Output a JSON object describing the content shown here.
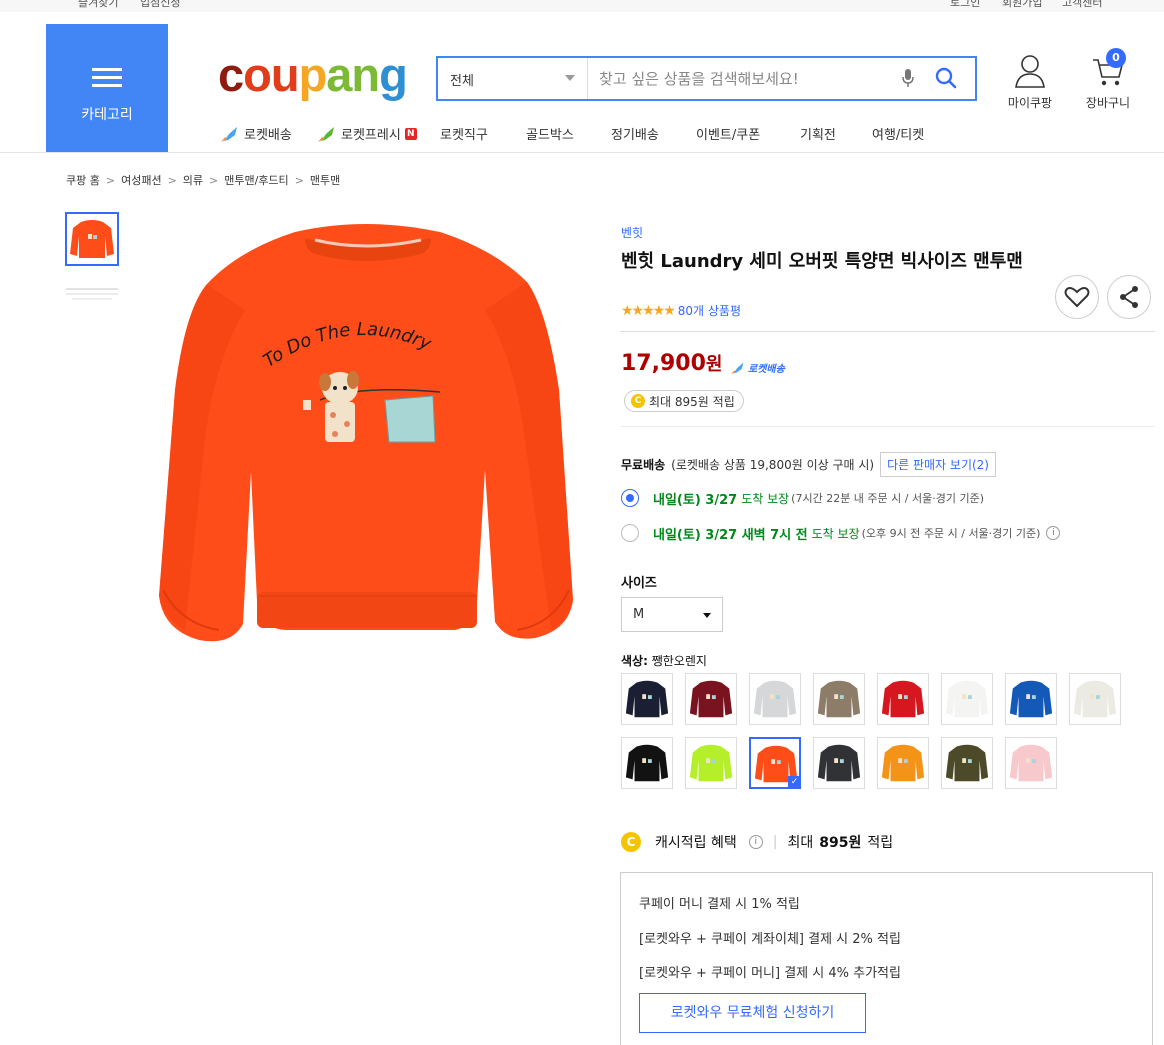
{
  "topbar": {
    "left_a": "즐겨찾기",
    "left_b": "입점신청",
    "right_a": "로그인",
    "right_b": "회원가입",
    "right_c": "고객센터"
  },
  "header": {
    "category_label": "카테고리",
    "logo": {
      "c": "c",
      "ou": "ou",
      "p": "p",
      "an": "an",
      "g": "g"
    },
    "search": {
      "scope": "전체",
      "placeholder": "찾고 싶은 상품을 검색해보세요!"
    },
    "my_coupang": "마이쿠팡",
    "cart": {
      "label": "장바구니",
      "count": "0"
    },
    "nav": [
      "로켓배송",
      "로켓프레시",
      "로켓직구",
      "골드박스",
      "정기배송",
      "이벤트/쿠폰",
      "기획전",
      "여행/티켓"
    ],
    "fresh_badge": "N"
  },
  "breadcrumb": [
    "쿠팡 홈",
    "여성패션",
    "의류",
    "맨투맨/후드티",
    "맨투맨"
  ],
  "sep": ">",
  "product": {
    "brand": "벤힛",
    "title": "벤힛 Laundry 세미 오버핏 특양면 빅사이즈 맨투맨",
    "rating_stars": 5,
    "stars_text": "★★★★★",
    "review_count": "80개 상품평",
    "graphic_text": "To Do The Laundry",
    "price": "17,900",
    "won": "원",
    "rocket_label": "로켓배송",
    "point_coin": "C",
    "point_text": "최대 895원 적립",
    "shipping": {
      "label": "무료배송",
      "condition": "(로켓배송 상품 19,800원 이상 구매 시)",
      "other_sellers": "다른 판매자 보기(2)"
    },
    "delivery_options": [
      {
        "day": "내일(토) 3/27",
        "guarantee": "도착 보장",
        "note": "(7시간 22분 내 주문 시 / 서울·경기 기준)",
        "selected": true
      },
      {
        "day": "내일(토) 3/27 새벽 7시 전",
        "guarantee": "도착 보장",
        "note": "(오후 9시 전 주문 시 / 서울·경기 기준)",
        "selected": false
      }
    ],
    "info_icon": "i",
    "size": {
      "label": "사이즈",
      "value": "M"
    },
    "color": {
      "label": "색상:",
      "value": "쨍한오렌지"
    },
    "swatches": [
      {
        "color": "#1b1f33"
      },
      {
        "color": "#7a1320"
      },
      {
        "color": "#d5d7d9"
      },
      {
        "color": "#8c7c68"
      },
      {
        "color": "#d7171f"
      },
      {
        "color": "#f4f4f2"
      },
      {
        "color": "#1559b8"
      },
      {
        "color": "#ecebe3"
      },
      {
        "color": "#121212"
      },
      {
        "color": "#b4ef2a"
      },
      {
        "color": "#ff4d1a",
        "selected": true
      },
      {
        "color": "#303235"
      },
      {
        "color": "#f39419"
      },
      {
        "color": "#4d4a2a"
      },
      {
        "color": "#f7c8cc"
      }
    ],
    "check_mark": "✓",
    "cash": {
      "coin": "C",
      "label": "캐시적립 혜택",
      "info": "i",
      "bar": "|",
      "prefix": "최대",
      "amount": "895원",
      "suffix": "적립"
    },
    "benefits": [
      "쿠페이 머니 결제 시 1% 적립",
      "[로켓와우 + 쿠페이 계좌이체] 결제 시 2% 적립",
      "[로켓와우 + 쿠페이 머니] 결제 시 4% 추가적립"
    ],
    "benefit_cta": "로켓와우 무료체험 신청하기"
  },
  "colors": {
    "accent": "#346aff",
    "price": "#ae0000",
    "green": "#00891a",
    "category_bg": "#4285f4",
    "shirt": "#ff4d1a"
  }
}
